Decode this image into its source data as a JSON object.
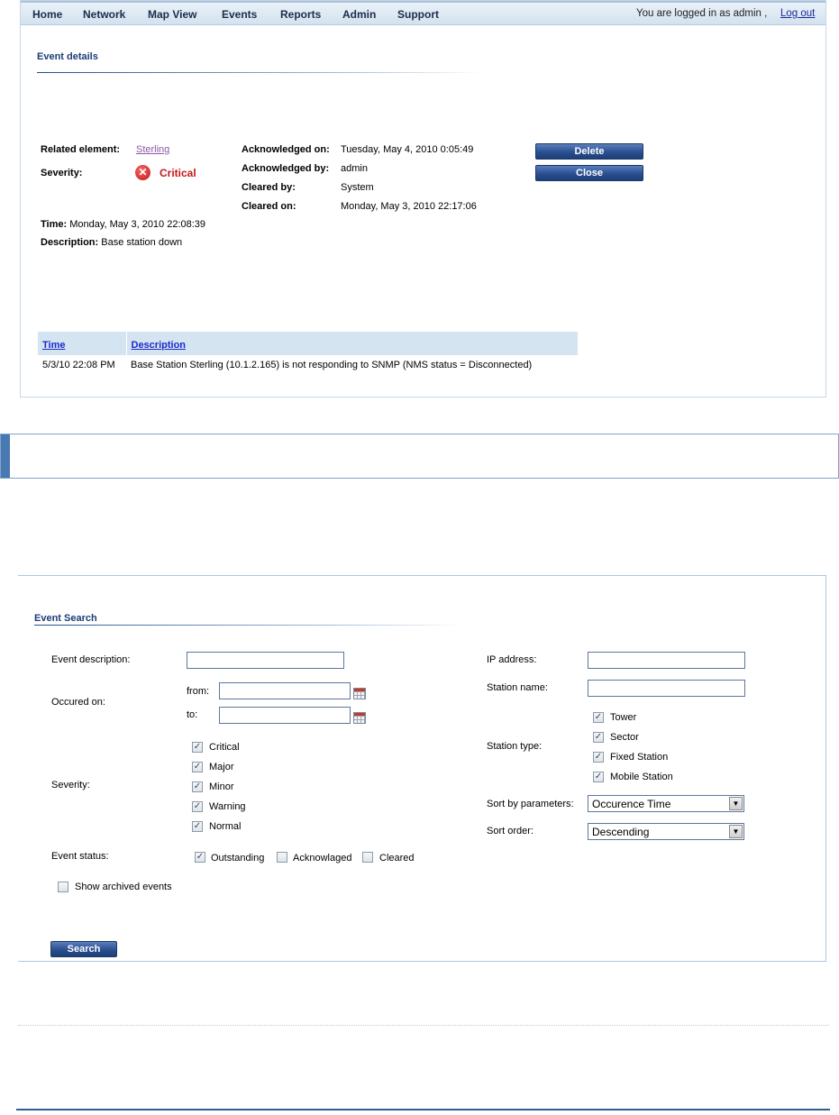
{
  "nav": {
    "items": [
      "Home",
      "Network",
      "Map View",
      "Events",
      "Reports",
      "Admin",
      "Support"
    ],
    "login_text": "You are logged in as admin ,",
    "logout": "Log out"
  },
  "event_details": {
    "title": "Event details",
    "related_element_label": "Related element:",
    "related_element_value": "Sterling",
    "severity_label": "Severity:",
    "severity_value": "Critical",
    "severity_icon": "critical-x-icon",
    "time_label": "Time:",
    "time_value": "Monday, May 3, 2010 22:08:39",
    "description_label": "Description:",
    "description_value": "Base station down",
    "ack_on_label": "Acknowledged on:",
    "ack_on_value": "Tuesday, May 4, 2010 0:05:49",
    "ack_by_label": "Acknowledged by:",
    "ack_by_value": "admin",
    "cleared_by_label": "Cleared by:",
    "cleared_by_value": "System",
    "cleared_on_label": "Cleared on:",
    "cleared_on_value": "Monday, May 3, 2010 22:17:06",
    "delete_button": "Delete",
    "close_button": "Close",
    "table": {
      "headers": [
        "Time",
        "Description"
      ],
      "rows": [
        [
          "5/3/10 22:08 PM",
          "Base Station Sterling (10.1.2.165) is not responding to SNMP (NMS status = Disconnected)"
        ]
      ]
    }
  },
  "event_search": {
    "title": "Event Search",
    "event_description_label": "Event description:",
    "event_description_value": "",
    "occured_on_label": "Occured on:",
    "from_label": "from:",
    "from_value": "",
    "to_label": "to:",
    "to_value": "",
    "severity_label": "Severity:",
    "severity_options": [
      {
        "label": "Critical",
        "checked": true
      },
      {
        "label": "Major",
        "checked": true
      },
      {
        "label": "Minor",
        "checked": true
      },
      {
        "label": "Warning",
        "checked": true
      },
      {
        "label": "Normal",
        "checked": true
      }
    ],
    "event_status_label": "Event status:",
    "status_options": [
      {
        "label": "Outstanding",
        "checked": true
      },
      {
        "label": "Acknowlaged",
        "checked": false
      },
      {
        "label": "Cleared",
        "checked": false
      }
    ],
    "show_archived_label": "Show archived events",
    "show_archived_checked": false,
    "ip_label": "IP address:",
    "ip_value": "",
    "station_name_label": "Station name:",
    "station_name_value": "",
    "station_type_label": "Station type:",
    "station_types": [
      {
        "label": "Tower",
        "checked": true
      },
      {
        "label": "Sector",
        "checked": true
      },
      {
        "label": "Fixed Station",
        "checked": true
      },
      {
        "label": "Mobile Station",
        "checked": true
      }
    ],
    "sort_by_label": "Sort by parameters:",
    "sort_by_value": "Occurence Time",
    "sort_order_label": "Sort order:",
    "sort_order_value": "Descending",
    "search_button": "Search"
  },
  "colors": {
    "nav_text": "#1b2d4a",
    "title_blue": "#1c3c78",
    "critical_red": "#c41818",
    "button_blue": "#2a4f8f",
    "table_header": "#d5e4f1"
  }
}
